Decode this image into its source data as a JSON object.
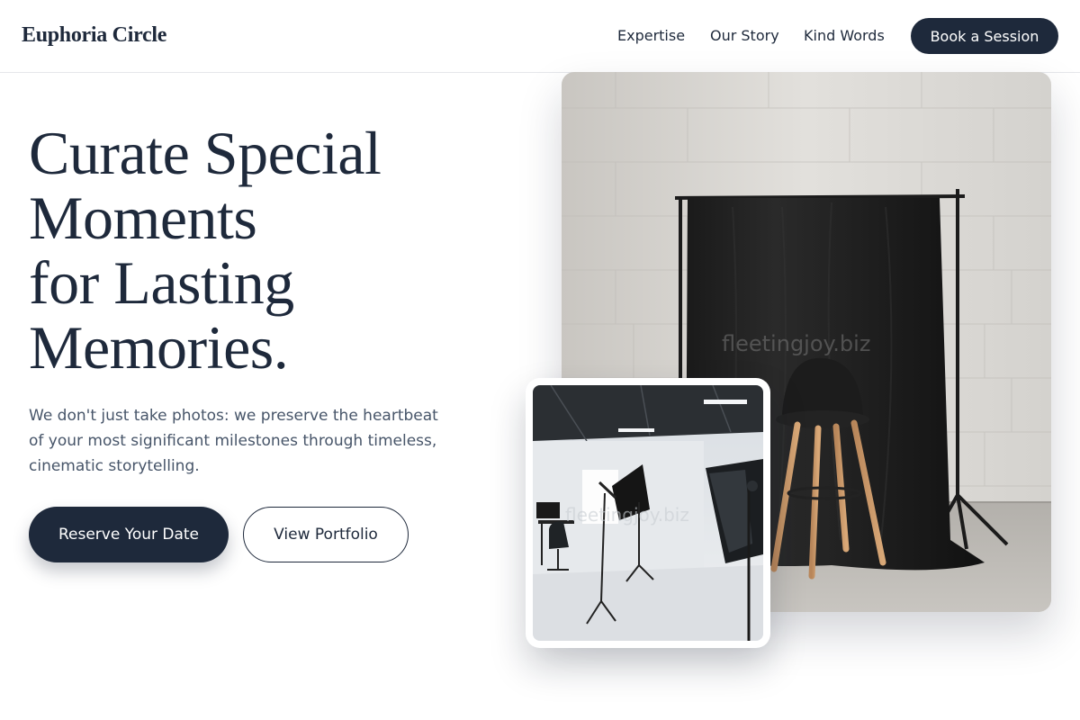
{
  "header": {
    "brand": "Euphoria Circle",
    "nav": [
      "Expertise",
      "Our Story",
      "Kind Words"
    ],
    "cta": "Book a Session"
  },
  "hero": {
    "title_lines": [
      "Curate Special",
      "Moments",
      "for Lasting",
      "Memories."
    ],
    "subtitle_lines": [
      "We don't just take photos: we preserve the heartbeat",
      "of your most significant milestones through timeless,",
      "cinematic storytelling."
    ],
    "primary_button": "Reserve Your Date",
    "secondary_button": "View Portfolio"
  },
  "images": {
    "main_watermark": "fleetingjoy.biz",
    "inset_watermark": "fleetingjoy.biz"
  },
  "colors": {
    "primary": "#1e293b",
    "text_muted": "#475569",
    "border": "#e5e7eb"
  }
}
